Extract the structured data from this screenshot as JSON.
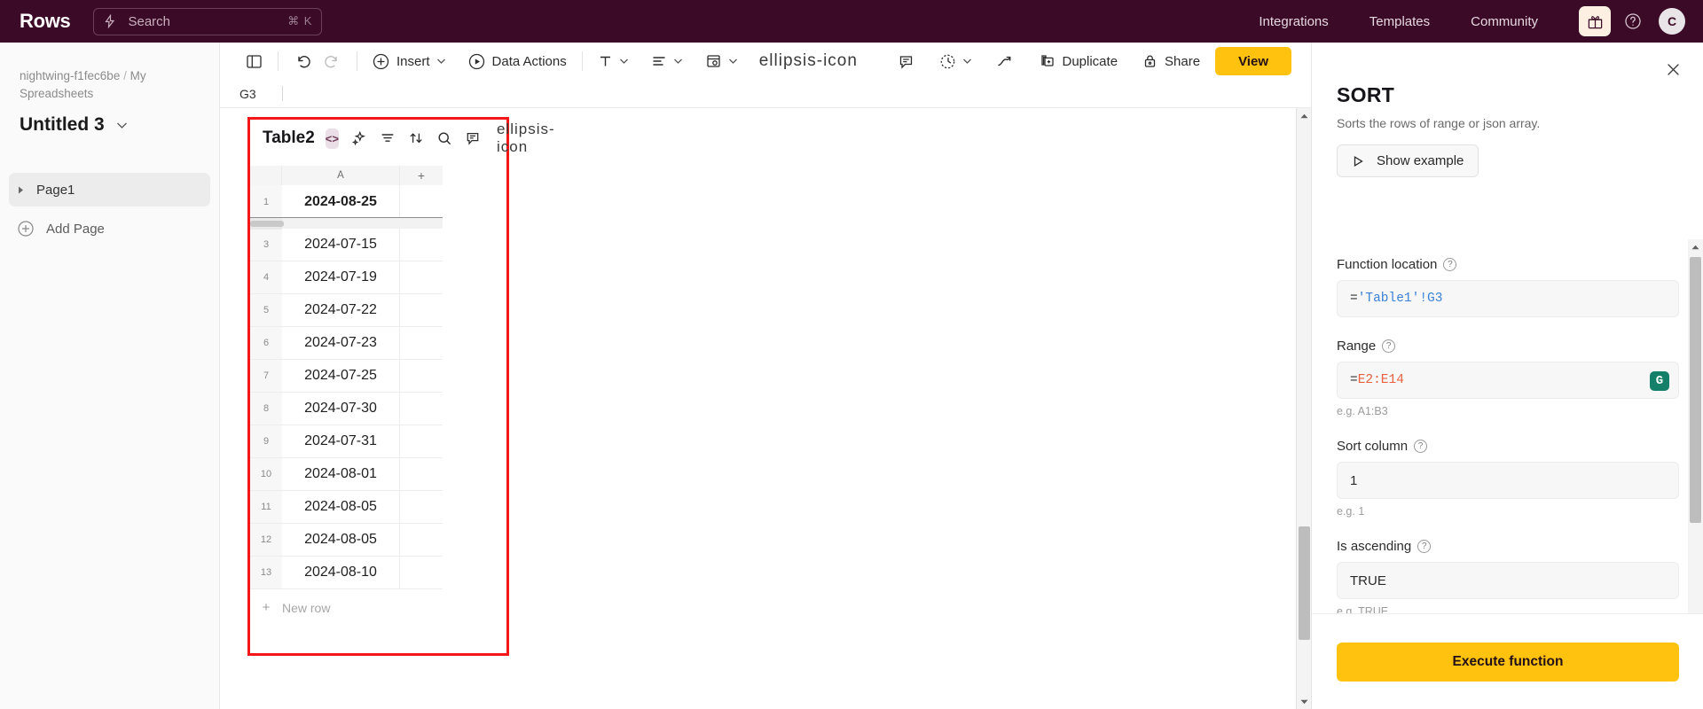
{
  "topbar": {
    "brand": "Rows",
    "search": {
      "placeholder": "Search",
      "shortcut": "⌘ K",
      "icon": "lightning-icon"
    },
    "nav": [
      {
        "label": "Integrations"
      },
      {
        "label": "Templates"
      },
      {
        "label": "Community"
      }
    ],
    "gift_icon": "gift-icon",
    "help_icon": "question-circle-icon",
    "avatar_initial": "C",
    "bg_color": "#3b0a26"
  },
  "sidebar": {
    "breadcrumb_workspace": "nightwing-f1fec6be",
    "breadcrumb_separator": "/",
    "breadcrumb_folder": "My Spreadsheets",
    "doc_title": "Untitled 3",
    "pages": [
      {
        "label": "Page1",
        "active": true
      }
    ],
    "add_page_label": "Add Page"
  },
  "toolbar": {
    "panel_toggle_icon": "sidebar-toggle-icon",
    "undo_icon": "undo-icon",
    "redo_icon": "redo-icon",
    "insert_label": "Insert",
    "data_actions_label": "Data Actions",
    "text_format_icon": "text-format-icon",
    "align_icon": "align-icon",
    "cell_style_icon": "cell-style-icon",
    "more_icon": "ellipsis-icon",
    "comment_icon": "comment-icon",
    "history_icon": "history-icon",
    "trend_icon": "trend-icon",
    "duplicate_label": "Duplicate",
    "share_label": "Share",
    "view_label": "View",
    "view_bg": "#ffc20e"
  },
  "refbar": {
    "cell_ref": "G3"
  },
  "sheet": {
    "table_name": "Table2",
    "code_chip": "<>",
    "header_icons": [
      "ai-sparkle-icon",
      "filter-icon",
      "sort-icon",
      "search-icon",
      "comment-icon"
    ],
    "more_icon": "ellipsis-icon",
    "column_headers": [
      "A"
    ],
    "add_column_label": "+",
    "new_row_label": "New row",
    "new_row_plus": "+",
    "highlight_color": "#f51717",
    "rows": [
      {
        "num": "1",
        "a": "2024-08-25",
        "selected": true
      },
      {
        "num": "3",
        "a": "2024-07-15",
        "selected": false
      },
      {
        "num": "4",
        "a": "2024-07-19",
        "selected": false
      },
      {
        "num": "5",
        "a": "2024-07-22",
        "selected": false
      },
      {
        "num": "6",
        "a": "2024-07-23",
        "selected": false
      },
      {
        "num": "7",
        "a": "2024-07-25",
        "selected": false
      },
      {
        "num": "8",
        "a": "2024-07-30",
        "selected": false
      },
      {
        "num": "9",
        "a": "2024-07-31",
        "selected": false
      },
      {
        "num": "10",
        "a": "2024-08-01",
        "selected": false
      },
      {
        "num": "11",
        "a": "2024-08-05",
        "selected": false
      },
      {
        "num": "12",
        "a": "2024-08-05",
        "selected": false
      },
      {
        "num": "13",
        "a": "2024-08-10",
        "selected": false
      }
    ]
  },
  "panel": {
    "close_icon": "close-icon",
    "function_name": "SORT",
    "function_description": "Sorts the rows of range or json array.",
    "show_example_label": "Show example",
    "show_example_icon": "play-icon",
    "fields": [
      {
        "label": "Function location",
        "help_icon": "question-circle-icon",
        "value_eq": "=",
        "value_ref": "'Table1'!G3",
        "hint": ""
      },
      {
        "label": "Range",
        "help_icon": "question-circle-icon",
        "value_eq": "=",
        "value_range": "E2:E14",
        "hint": "e.g. A1:B3",
        "grammarly_icon": "grammarly-icon"
      },
      {
        "label": "Sort column",
        "help_icon": "question-circle-icon",
        "value": "1",
        "hint": "e.g. 1"
      },
      {
        "label": "Is ascending",
        "help_icon": "question-circle-icon",
        "value": "TRUE",
        "hint": "e.g. TRUE"
      }
    ],
    "execute_label": "Execute function",
    "execute_bg": "#ffc20e"
  }
}
